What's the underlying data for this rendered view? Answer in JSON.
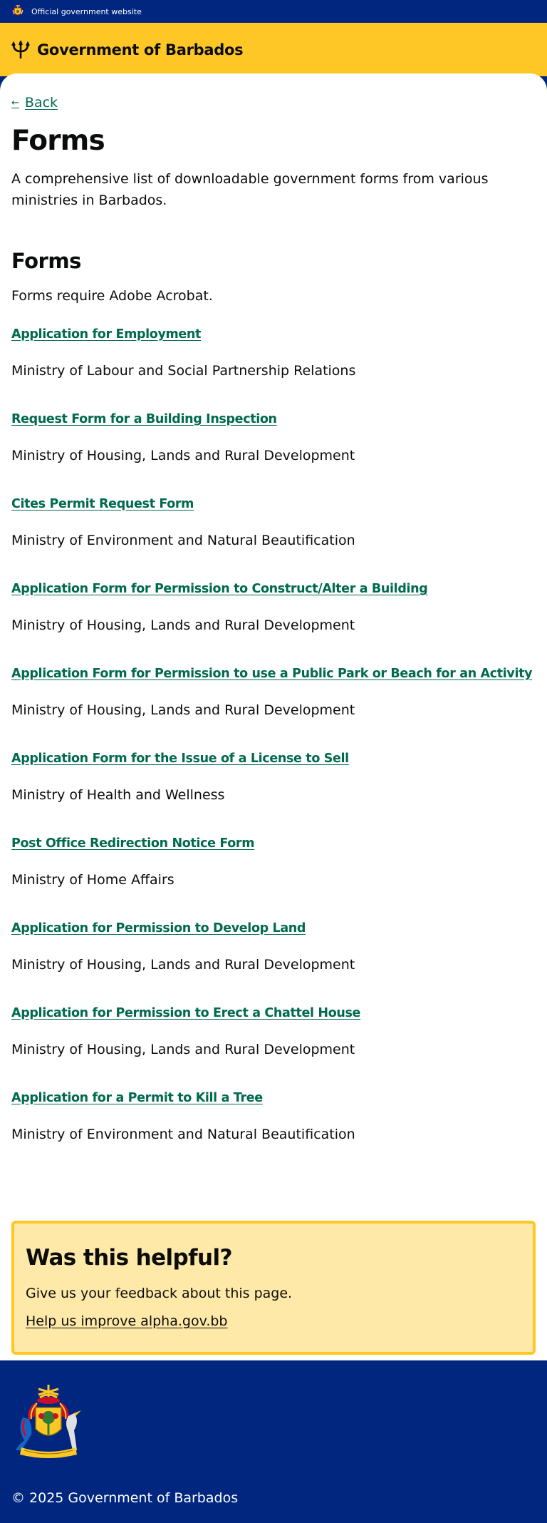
{
  "topbar": {
    "official_label": "Official government website"
  },
  "header": {
    "site_title": "Government of Barbados"
  },
  "back": {
    "label": "Back"
  },
  "page": {
    "title": "Forms",
    "intro": "A comprehensive list of downloadable government forms from various ministries in Barbados."
  },
  "section": {
    "title": "Forms",
    "note": "Forms require Adobe Acrobat."
  },
  "forms": [
    {
      "title": "Application for Employment",
      "ministry": "Ministry of Labour and Social Partnership Relations"
    },
    {
      "title": "Request Form for a Building Inspection",
      "ministry": "Ministry of Housing, Lands and Rural Development"
    },
    {
      "title": "Cites Permit Request Form",
      "ministry": "Ministry of Environment and Natural Beautification"
    },
    {
      "title": "Application Form for Permission to Construct/Alter a Building",
      "ministry": "Ministry of Housing, Lands and Rural Development"
    },
    {
      "title": "Application Form for Permission to use a Public Park or Beach for an Activity",
      "ministry": "Ministry of Housing, Lands and Rural Development"
    },
    {
      "title": "Application Form for the Issue of a License to Sell",
      "ministry": "Ministry of Health and Wellness"
    },
    {
      "title": "Post Office Redirection Notice Form",
      "ministry": "Ministry of Home Affairs"
    },
    {
      "title": "Application for Permission to Develop Land",
      "ministry": "Ministry of Housing, Lands and Rural Development"
    },
    {
      "title": "Application for Permission to Erect a Chattel House",
      "ministry": "Ministry of Housing, Lands and Rural Development"
    },
    {
      "title": "Application for a Permit to Kill a Tree",
      "ministry": "Ministry of Environment and Natural Beautification"
    }
  ],
  "feedback": {
    "title": "Was this helpful?",
    "text": "Give us your feedback about this page.",
    "link": "Help us improve alpha.gov.bb"
  },
  "footer": {
    "copyright": "© 2025 Government of Barbados"
  },
  "colors": {
    "navy": "#00267f",
    "gold": "#ffc726",
    "link_green": "#006a4e",
    "feedback_bg": "#ffe9a8"
  },
  "icons": {
    "top_crest": "coat-of-arms-icon",
    "logo": "trident-icon",
    "back": "arrow-left-icon",
    "footer_crest": "coat-of-arms-icon"
  }
}
